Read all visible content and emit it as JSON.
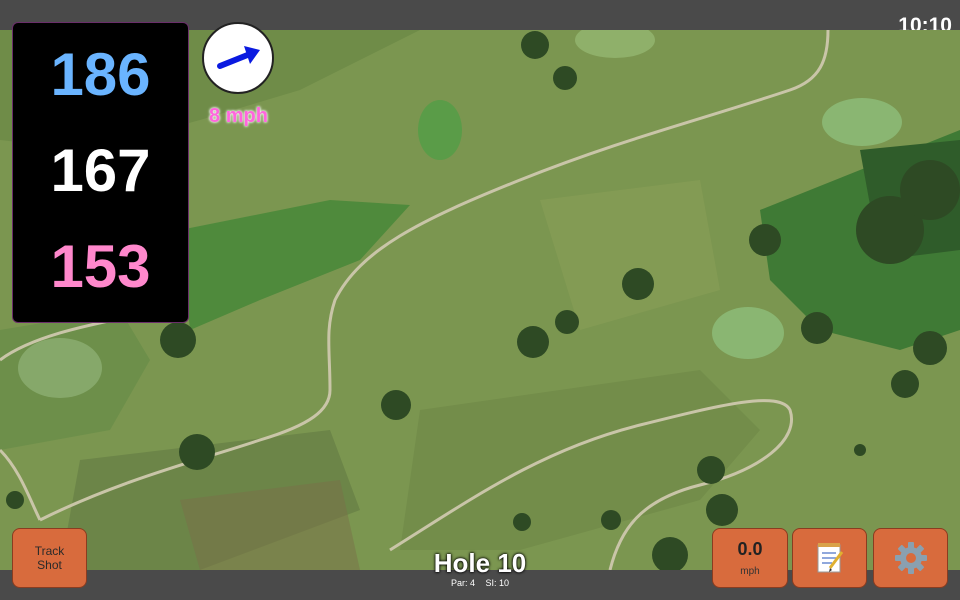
{
  "status_bar": {
    "time": "10:10"
  },
  "distances": {
    "back": "186",
    "middle": "167",
    "front": "153",
    "colors": {
      "back": "#6ab4ff",
      "middle": "#ffffff",
      "front": "#ff88cc"
    }
  },
  "wind": {
    "speed_label": "8 mph",
    "icon": "wind-direction-arrow"
  },
  "buttons": {
    "track_shot": {
      "line1": "Track",
      "line2": "Shot"
    },
    "speed": {
      "value": "0.0",
      "unit": "mph"
    },
    "notes": {
      "icon": "notepad-icon"
    },
    "settings": {
      "icon": "gear-icon"
    }
  },
  "hole": {
    "title": "Hole 10",
    "par": "Par: 4",
    "si": "SI: 10"
  },
  "colors": {
    "button": "#d86b3d",
    "bar": "#4a4a4a",
    "fairway": "#7d9a52"
  }
}
